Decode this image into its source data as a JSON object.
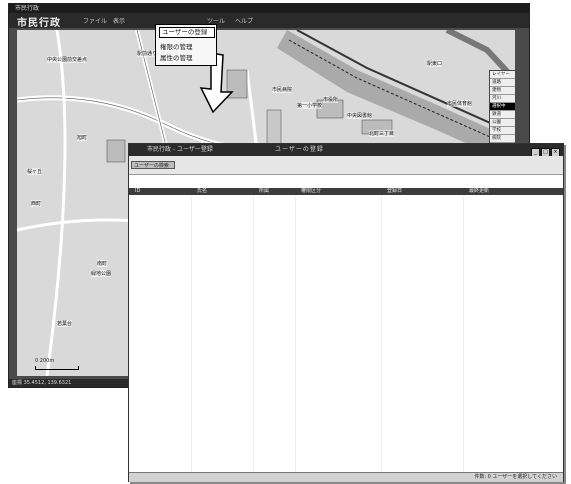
{
  "main_window": {
    "app_title": "市民行政",
    "menu": [
      "ファイル",
      "表示",
      "ツール",
      "ヘルプ"
    ],
    "statusbar": "座標 35.4512, 139.6321"
  },
  "dropdown": {
    "items": [
      "ユーザーの登録",
      "権限の管理",
      "属性の管理"
    ]
  },
  "map": {
    "labels": [
      "中央公園前交差点",
      "駅前通り",
      "市民病院",
      "第一小学校",
      "市役所",
      "中央図書館",
      "北町三丁目",
      "旭町",
      "桜ヶ丘",
      "東町",
      "市民体育館",
      "駅東口",
      "西町",
      "南町",
      "緑地公園",
      "若葉台"
    ],
    "scale_label": "0    200m",
    "layers": [
      "レイヤー",
      "道路",
      "建物",
      "河川",
      "鉄道",
      "公園",
      "学校",
      "病院",
      "施設",
      "地名",
      "境界",
      "等高線",
      "地番",
      "その他",
      "選択中"
    ]
  },
  "user_window": {
    "app_name": "市民行政 - ユーザー登録",
    "title": "ユーザーの登録",
    "search_value": "ユーザーの検索",
    "columns": [
      "ID",
      "氏名",
      "所属",
      "権限区分",
      "登録日",
      "最終更新"
    ],
    "status": "件数: 0   ユーザーを選択してください"
  },
  "colors": {
    "map_bg": "#d9d9d9",
    "window_chrome": "#2b2b2b"
  }
}
